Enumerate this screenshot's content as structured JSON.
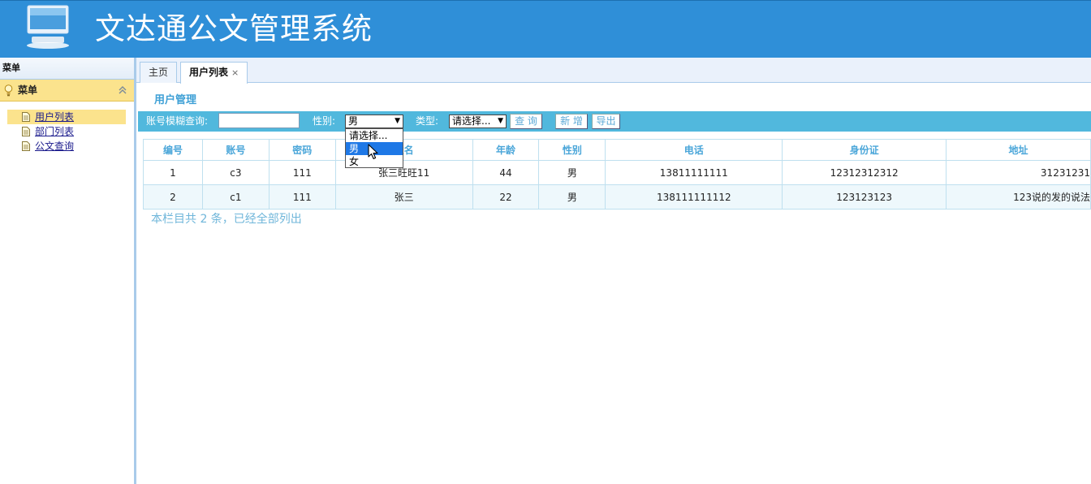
{
  "app": {
    "title": "文达通公文管理系统"
  },
  "left_panel": {
    "title": "菜单",
    "accordion": {
      "label": "菜单"
    },
    "items": [
      {
        "label": "用户列表",
        "selected": true
      },
      {
        "label": "部门列表",
        "selected": false
      },
      {
        "label": "公文查询",
        "selected": false
      }
    ]
  },
  "tabs": [
    {
      "label": "主页",
      "active": false
    },
    {
      "label": "用户列表",
      "active": true,
      "close": "×"
    }
  ],
  "section": {
    "title": "用户管理"
  },
  "search": {
    "account_label": "账号模糊查询:",
    "account_value": "",
    "gender_label": "性别:",
    "gender_value": "男",
    "type_label": "类型:",
    "type_value": "请选择...",
    "query_button": "查 询",
    "add_button": "新 增",
    "export_button": "导出"
  },
  "gender_dropdown": {
    "options": [
      "请选择...",
      "男",
      "女"
    ],
    "highlighted": "男"
  },
  "table": {
    "columns": [
      "编号",
      "账号",
      "密码",
      "姓名",
      "年龄",
      "性别",
      "电话",
      "身份证",
      "地址"
    ],
    "rows": [
      [
        "1",
        "c3",
        "111",
        "张三旺旺11",
        "44",
        "男",
        "13811111111",
        "12312312312",
        "31231231"
      ],
      [
        "2",
        "c1",
        "111",
        "张三",
        "22",
        "男",
        "138111111112",
        "123123123",
        "123说的发的说法"
      ]
    ],
    "footer": "本栏目共 2 条，已经全部列出"
  },
  "colors": {
    "header_bg": "#2f8fd8",
    "searchbar_bg": "#51b8dd",
    "accent_yellow": "#fbe38d",
    "table_header_text": "#4aa6d9"
  }
}
